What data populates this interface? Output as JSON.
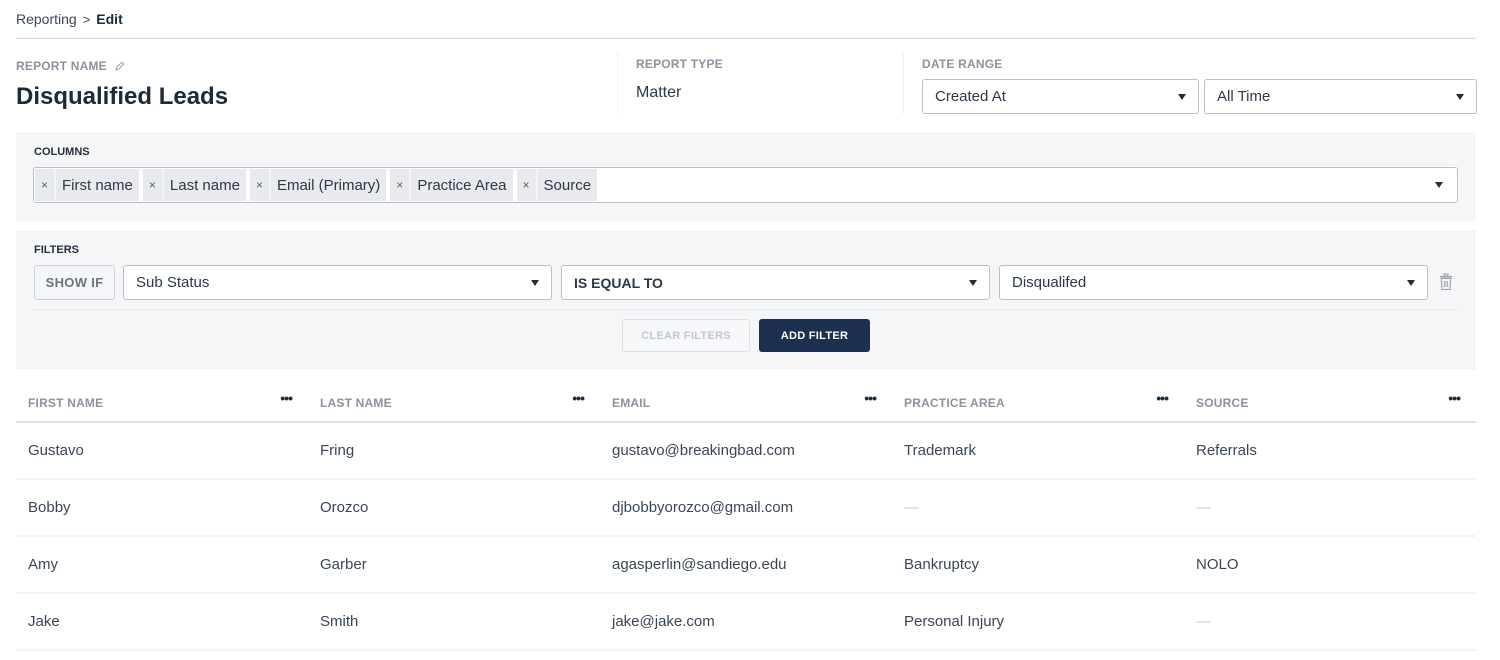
{
  "breadcrumb": {
    "parent": "Reporting",
    "separator": ">",
    "current": "Edit"
  },
  "report_name": {
    "label": "REPORT NAME",
    "value": "Disqualified Leads",
    "edit_icon": "pencil-icon"
  },
  "report_type": {
    "label": "REPORT TYPE",
    "value": "Matter"
  },
  "date_range": {
    "label": "DATE RANGE",
    "field": "Created At",
    "range": "All Time"
  },
  "columns": {
    "label": "COLUMNS",
    "tags": [
      "First name",
      "Last name",
      "Email (Primary)",
      "Practice Area",
      "Source"
    ],
    "remove_glyph": "×"
  },
  "filters": {
    "label": "FILTERS",
    "show_if": "SHOW IF",
    "field": "Sub Status",
    "operator": "IS EQUAL TO",
    "value": "Disqualifed",
    "delete_icon": "trash-icon",
    "clear_label": "CLEAR FILTERS",
    "add_label": "ADD FILTER"
  },
  "table": {
    "headers": [
      "FIRST NAME",
      "LAST NAME",
      "EMAIL",
      "PRACTICE AREA",
      "SOURCE"
    ],
    "menu_glyph": "•••",
    "rows": [
      [
        "Gustavo",
        "Fring",
        "gustavo@breakingbad.com",
        "Trademark",
        "Referrals"
      ],
      [
        "Bobby",
        "Orozco",
        "djbobbyorozco@gmail.com",
        "—",
        "—"
      ],
      [
        "Amy",
        "Garber",
        "agasperlin@sandiego.edu",
        "Bankruptcy",
        "NOLO"
      ],
      [
        "Jake",
        "Smith",
        "jake@jake.com",
        "Personal Injury",
        "—"
      ]
    ]
  },
  "colors": {
    "primary_button": "#1c3150",
    "panel_bg": "#f5f6f8",
    "text_dark": "#1c2a3a"
  }
}
